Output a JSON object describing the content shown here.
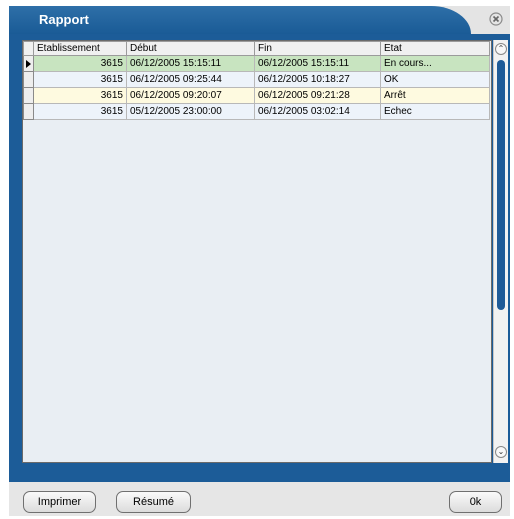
{
  "window": {
    "title": "Rapport",
    "close_icon": "close-icon"
  },
  "table": {
    "columns": [
      "Etablissement",
      "Début",
      "Fin",
      "Etat"
    ],
    "rows": [
      {
        "etablissement": "3615",
        "debut": "06/12/2005 15:15:11",
        "fin": "06/12/2005 15:15:11",
        "etat": "En cours...",
        "status_color": "#c8e4c0",
        "selected": true
      },
      {
        "etablissement": "3615",
        "debut": "06/12/2005 09:25:44",
        "fin": "06/12/2005 10:18:27",
        "etat": "OK",
        "status_color": "#edf3fa",
        "selected": false
      },
      {
        "etablissement": "3615",
        "debut": "06/12/2005 09:20:07",
        "fin": "06/12/2005 09:21:28",
        "etat": "Arrêt",
        "status_color": "#fefae0",
        "selected": false
      },
      {
        "etablissement": "3615",
        "debut": "05/12/2005 23:00:00",
        "fin": "06/12/2005 03:02:14",
        "etat": "Echec",
        "status_color": "#edf3fa",
        "selected": false
      }
    ]
  },
  "buttons": {
    "print": "Imprimer",
    "summary": "Résumé",
    "ok": "0k"
  },
  "colors": {
    "accent": "#1c5c98",
    "grid_bg": "#e9eef3"
  }
}
